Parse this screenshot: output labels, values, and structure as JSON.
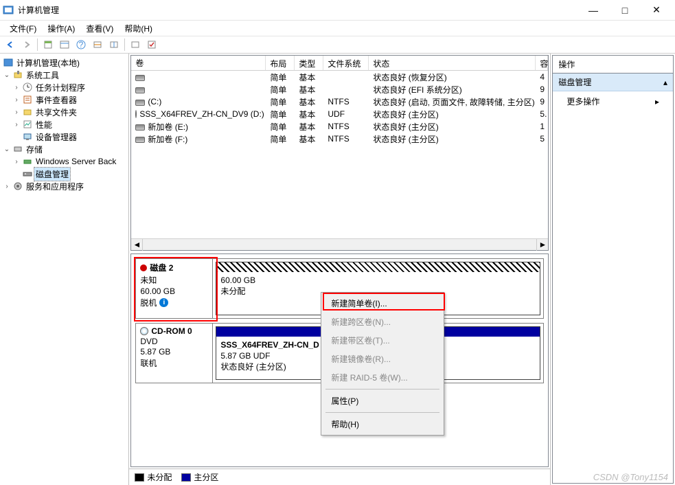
{
  "window": {
    "title": "计算机管理"
  },
  "menubar": {
    "file": "文件(F)",
    "action": "操作(A)",
    "view": "查看(V)",
    "help": "帮助(H)"
  },
  "tree": {
    "root": "计算机管理(本地)",
    "system_tools": "系统工具",
    "task_scheduler": "任务计划程序",
    "event_viewer": "事件查看器",
    "shared_folders": "共享文件夹",
    "performance": "性能",
    "device_manager": "设备管理器",
    "storage": "存储",
    "wsb": "Windows Server Back",
    "disk_mgmt": "磁盘管理",
    "services": "服务和应用程序"
  },
  "vol_columns": {
    "vol": "卷",
    "layout": "布局",
    "type": "类型",
    "fs": "文件系统",
    "status": "状态",
    "cap": "容"
  },
  "volumes": [
    {
      "name": "",
      "layout": "简单",
      "type": "基本",
      "fs": "",
      "status": "状态良好 (恢复分区)",
      "cap": "4"
    },
    {
      "name": "",
      "layout": "简单",
      "type": "基本",
      "fs": "",
      "status": "状态良好 (EFI 系统分区)",
      "cap": "9"
    },
    {
      "name": "(C:)",
      "layout": "简单",
      "type": "基本",
      "fs": "NTFS",
      "status": "状态良好 (启动, 页面文件, 故障转储, 主分区)",
      "cap": "9"
    },
    {
      "name": "SSS_X64FREV_ZH-CN_DV9 (D:)",
      "layout": "简单",
      "type": "基本",
      "fs": "UDF",
      "status": "状态良好 (主分区)",
      "cap": "5."
    },
    {
      "name": "新加卷 (E:)",
      "layout": "简单",
      "type": "基本",
      "fs": "NTFS",
      "status": "状态良好 (主分区)",
      "cap": "1"
    },
    {
      "name": "新加卷 (F:)",
      "layout": "简单",
      "type": "基本",
      "fs": "NTFS",
      "status": "状态良好 (主分区)",
      "cap": "5"
    }
  ],
  "disk2": {
    "title": "磁盘 2",
    "status1": "未知",
    "size": "60.00 GB",
    "status2": "脱机",
    "part_size": "60.00 GB",
    "part_label": "未分配"
  },
  "cdrom": {
    "title": "CD-ROM 0",
    "type": "DVD",
    "size": "5.87 GB",
    "status": "联机",
    "part_name": "SSS_X64FREV_ZH-CN_D",
    "part_size": "5.87 GB UDF",
    "part_status": "状态良好 (主分区)"
  },
  "ctx": {
    "simple": "新建简单卷(I)...",
    "spanned": "新建跨区卷(N)...",
    "striped": "新建带区卷(T)...",
    "mirror": "新建镜像卷(R)...",
    "raid5": "新建 RAID-5 卷(W)...",
    "props": "属性(P)",
    "help": "帮助(H)"
  },
  "legend": {
    "unalloc": "未分配",
    "primary": "主分区"
  },
  "actions": {
    "header": "操作",
    "section": "磁盘管理",
    "more": "更多操作"
  },
  "watermark": "CSDN @Tony1154"
}
